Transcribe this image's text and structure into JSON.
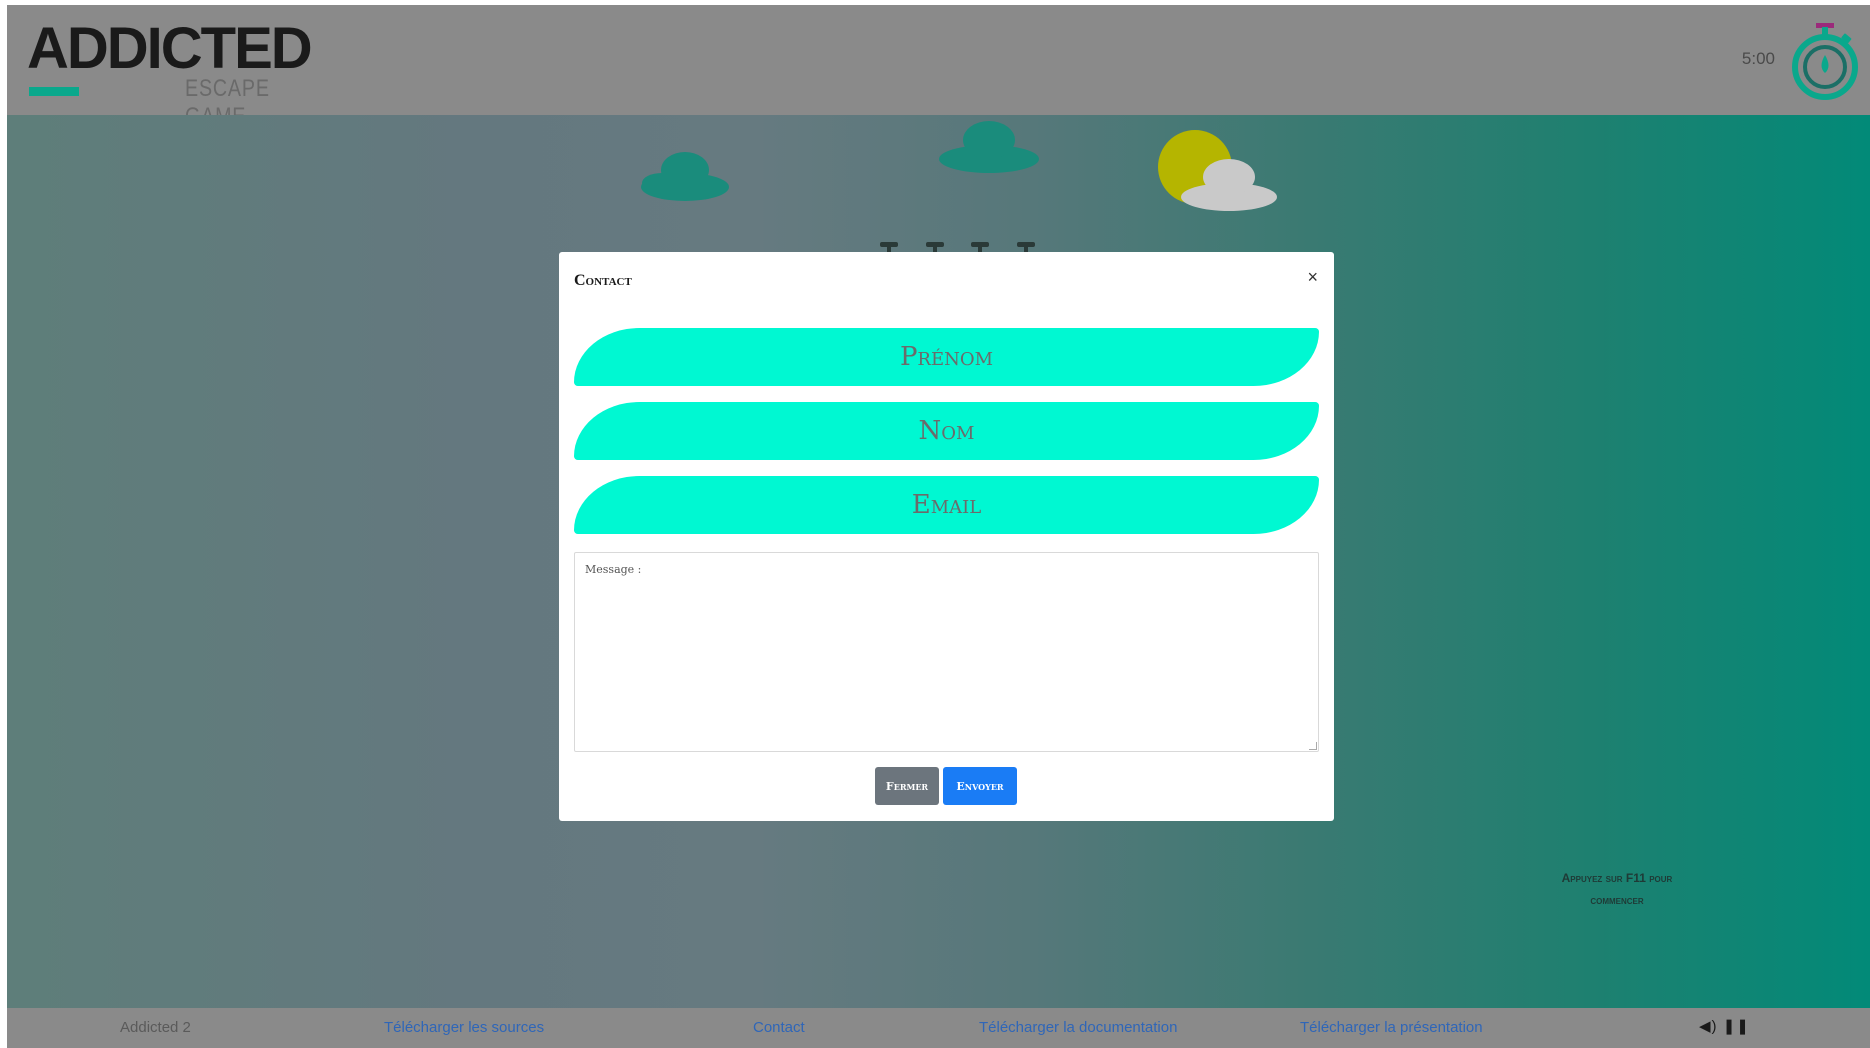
{
  "header": {
    "logo_title": "ADDICTED",
    "logo_subtitle": "ESCAPE GAME",
    "timer": "5:00",
    "timer_icon": "stopwatch-icon"
  },
  "colors": {
    "header_bg": "#8a8a8a",
    "accent": "#0aa88c",
    "pill": "#00f8d2",
    "primary_button": "#1a7cf5",
    "secondary_button": "#6c757d"
  },
  "modal": {
    "title": "Contact",
    "close_label": "×",
    "fields": {
      "prenom_placeholder": "Prénom",
      "nom_placeholder": "Nom",
      "email_placeholder": "Email",
      "message_placeholder": "Message :"
    },
    "buttons": {
      "close": "Fermer",
      "send": "Envoyer"
    }
  },
  "hint": {
    "line1": "Appuyez sur F11 pour",
    "line2": "commencer"
  },
  "footer": {
    "app_name": "Addicted 2",
    "links": {
      "sources": "Télécharger les sources",
      "contact": "Contact",
      "documentation": "Télécharger la documentation",
      "presentation": "Télécharger la présentation"
    },
    "sound_control": "◀) ❚❚"
  }
}
